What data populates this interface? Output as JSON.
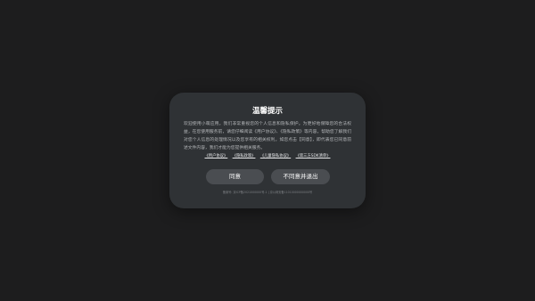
{
  "dialog": {
    "title": "温馨提示",
    "body": "欢迎使用小萌应用。我们非常重视您的个人信息和隐私保护。为更好地保障您的合法权益，在您使用服务前，请您仔细阅读《用户协议》、《隐私政策》等内容，帮助您了解我们对您个人信息的处理情况以及您享有的相关权利。如您点击【同意】，即代表您已同意前述文件内容，我们才能为您提供相关服务。",
    "links": [
      "《用户协议》",
      "《隐私政策》",
      "《儿童隐私协议》",
      "《第三方SDK清单》"
    ],
    "agree_label": "同意",
    "reject_label": "不同意并退出",
    "footer": "备案号: 京ICP备2021000000号-1 | 京公网安备11010000000000号"
  },
  "colors": {
    "background": "#1d1d1e",
    "dialog": "#2f3235",
    "button": "#4a4d51"
  }
}
